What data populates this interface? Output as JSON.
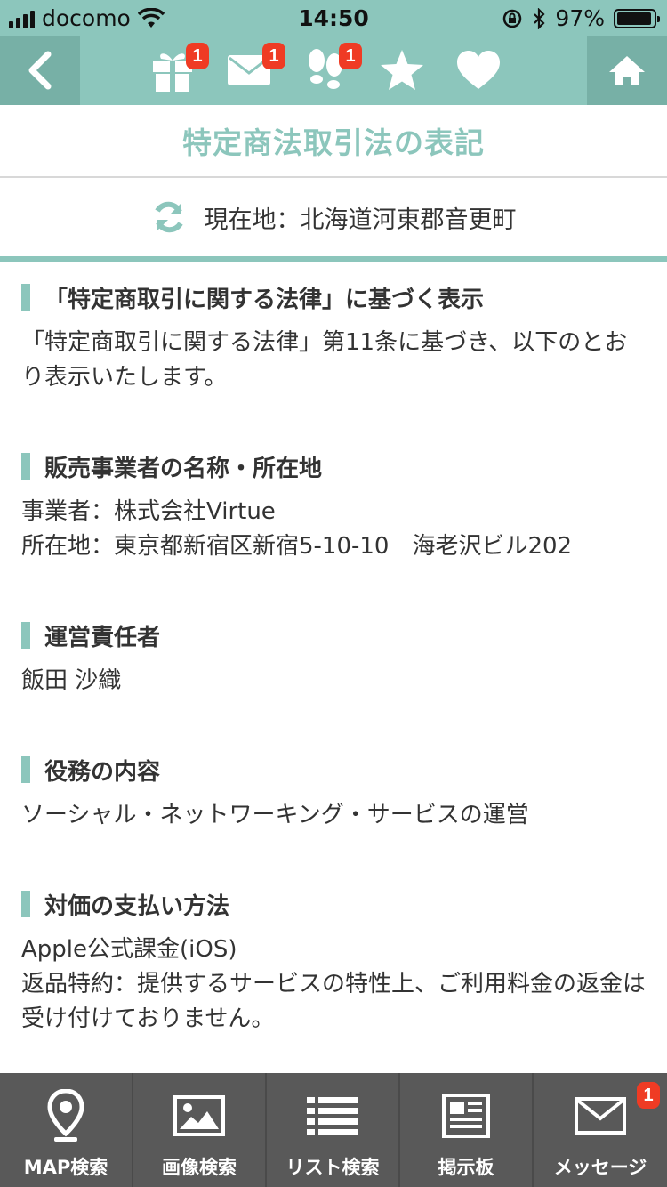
{
  "status_bar": {
    "carrier": "docomo",
    "time": "14:50",
    "battery": "97%"
  },
  "nav": {
    "badges": {
      "gift": "1",
      "mail": "1",
      "footprints": "1"
    },
    "icons": [
      "chevron-left-icon",
      "gift-icon",
      "mail-icon",
      "footprints-icon",
      "star-icon",
      "heart-icon",
      "home-icon"
    ]
  },
  "page": {
    "title": "特定商法取引法の表記"
  },
  "location": {
    "text": "現在地：北海道河東郡音更町"
  },
  "sections": [
    {
      "heading": "「特定商取引に関する法律」に基づく表示",
      "lines": [
        "「特定商取引に関する法律」第11条に基づき、以下のとおり表示いたします。"
      ]
    },
    {
      "heading": "販売事業者の名称・所在地",
      "lines": [
        "事業者：株式会社Virtue",
        "所在地：東京都新宿区新宿5-10-10　海老沢ビル202"
      ]
    },
    {
      "heading": "運営責任者",
      "lines": [
        "飯田 沙織"
      ]
    },
    {
      "heading": "役務の内容",
      "lines": [
        "ソーシャル・ネットワーキング・サービスの運営"
      ]
    },
    {
      "heading": "対価の支払い方法",
      "lines": [
        "Apple公式課金(iOS)",
        "返品特約：提供するサービスの特性上、ご利用料金の返金は受け付けておりません。"
      ]
    }
  ],
  "tabbar": {
    "items": [
      {
        "label": "MAP検索",
        "icon": "map-pin-icon"
      },
      {
        "label": "画像検索",
        "icon": "image-icon"
      },
      {
        "label": "リスト検索",
        "icon": "list-icon"
      },
      {
        "label": "掲示板",
        "icon": "newspaper-icon"
      },
      {
        "label": "メッセージ",
        "icon": "mail-icon",
        "badge": "1"
      }
    ]
  },
  "colors": {
    "accent": "#8cc6bc",
    "accent_dark": "#77b0a6",
    "badge": "#ef3b24",
    "tabbar": "#595959"
  }
}
